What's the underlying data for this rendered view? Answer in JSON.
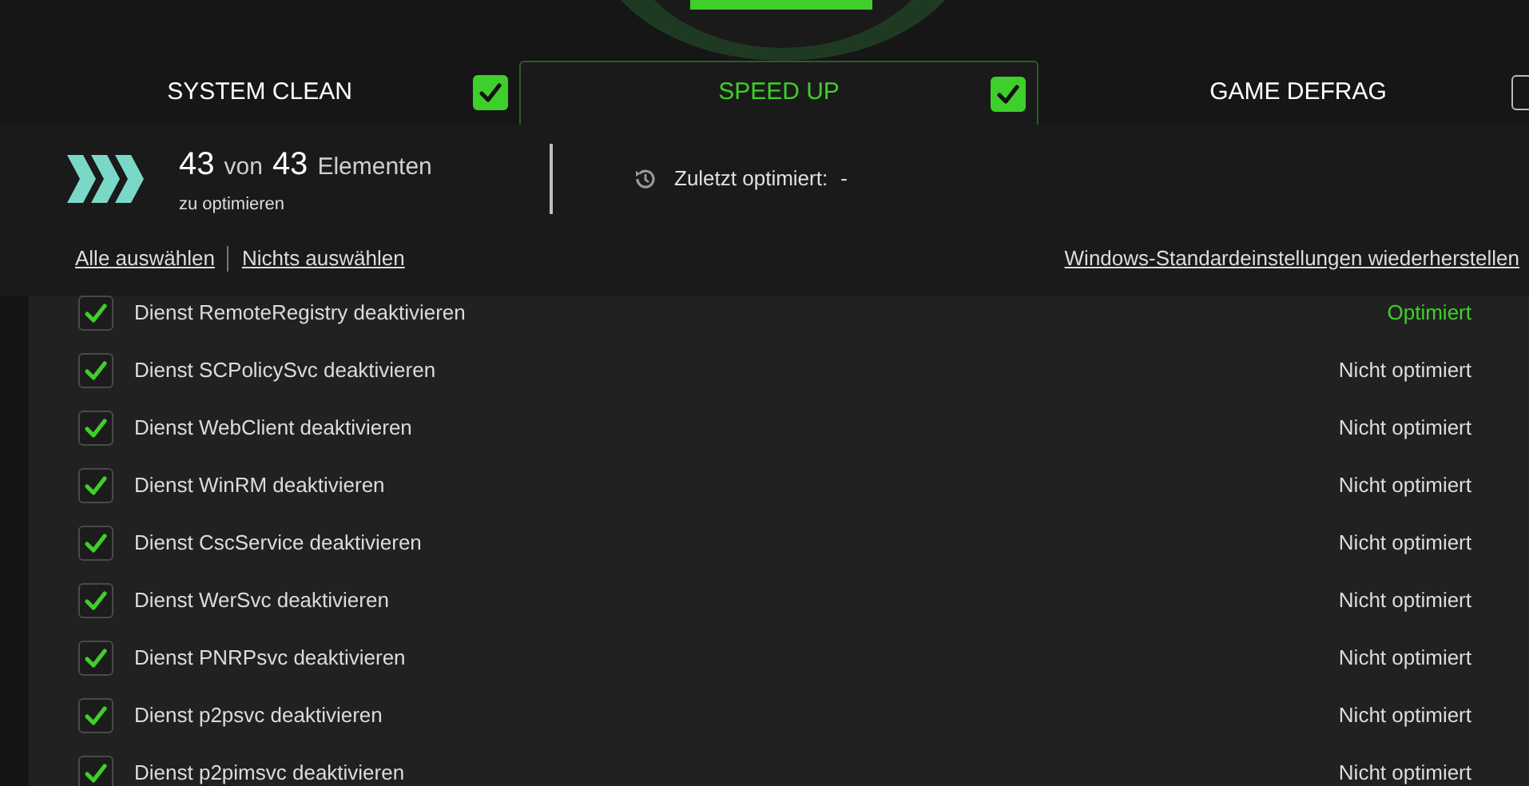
{
  "tabs": [
    {
      "label": "SYSTEM CLEAN",
      "selected": false,
      "checked": true
    },
    {
      "label": "SPEED UP",
      "selected": true,
      "checked": true
    },
    {
      "label": "GAME DEFRAG",
      "selected": false,
      "checked": false
    }
  ],
  "summary": {
    "count": "43",
    "of": "von",
    "total": "43",
    "unit": "Elementen",
    "subtitle": "zu optimieren",
    "last_label": "Zuletzt optimiert:",
    "last_value": "-"
  },
  "links": [
    "Alle auswählen",
    "Nichts auswählen"
  ],
  "restore_link": "Windows-Standardeinstellungen wiederherstellen",
  "items": [
    {
      "label": "Dienst RemoteRegistry deaktivieren",
      "checked": true,
      "status": "Optimiert",
      "optimized": true
    },
    {
      "label": "Dienst SCPolicySvc deaktivieren",
      "checked": true,
      "status": "Nicht optimiert",
      "optimized": false
    },
    {
      "label": "Dienst WebClient deaktivieren",
      "checked": true,
      "status": "Nicht optimiert",
      "optimized": false
    },
    {
      "label": "Dienst WinRM deaktivieren",
      "checked": true,
      "status": "Nicht optimiert",
      "optimized": false
    },
    {
      "label": "Dienst CscService deaktivieren",
      "checked": true,
      "status": "Nicht optimiert",
      "optimized": false
    },
    {
      "label": "Dienst WerSvc deaktivieren",
      "checked": true,
      "status": "Nicht optimiert",
      "optimized": false
    },
    {
      "label": "Dienst PNRPsvc deaktivieren",
      "checked": true,
      "status": "Nicht optimiert",
      "optimized": false
    },
    {
      "label": "Dienst p2psvc deaktivieren",
      "checked": true,
      "status": "Nicht optimiert",
      "optimized": false
    },
    {
      "label": "Dienst p2pimsvc deaktivieren",
      "checked": true,
      "status": "Nicht optimiert",
      "optimized": false
    }
  ]
}
